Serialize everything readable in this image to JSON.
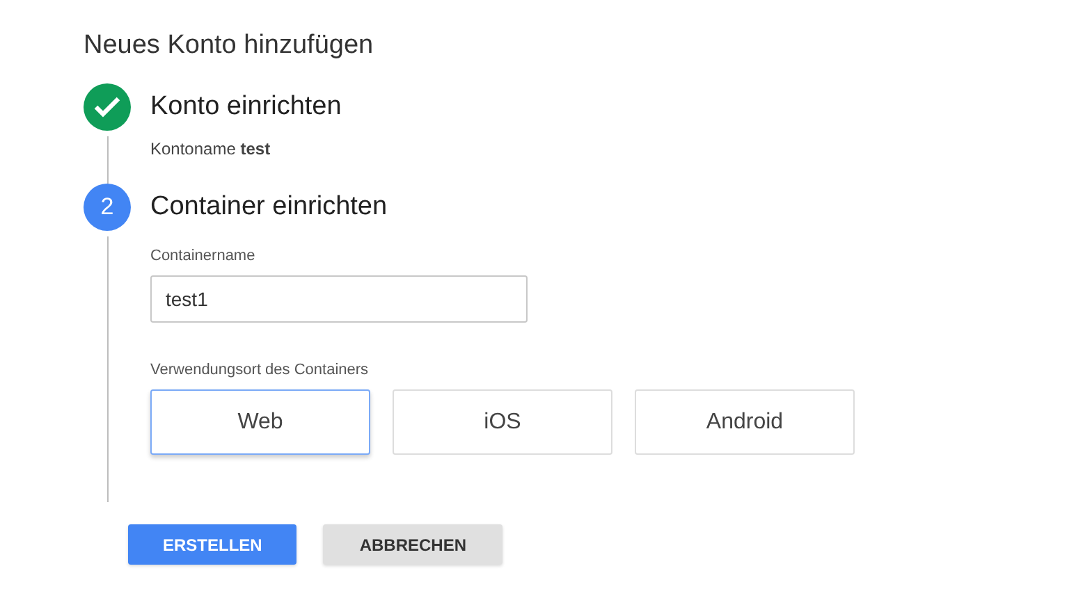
{
  "title": "Neues Konto hinzufügen",
  "steps": [
    {
      "kind": "done",
      "title": "Konto einrichten",
      "summary": "Kontoname **test**"
    },
    {
      "kind": "active",
      "number": "2",
      "title": "Container einrichten",
      "field": {
        "label": "Containername",
        "value": "test1"
      },
      "platform_label": "Verwendungsort des Containers",
      "platforms": [
        {
          "label": "Web",
          "selected": true
        },
        {
          "label": "iOS",
          "selected": false
        },
        {
          "label": "Android",
          "selected": false
        }
      ]
    }
  ],
  "buttons": [
    {
      "label": "ERSTELLEN",
      "kind": "primary"
    },
    {
      "label": "ABBRECHEN",
      "kind": "secondary"
    }
  ]
}
